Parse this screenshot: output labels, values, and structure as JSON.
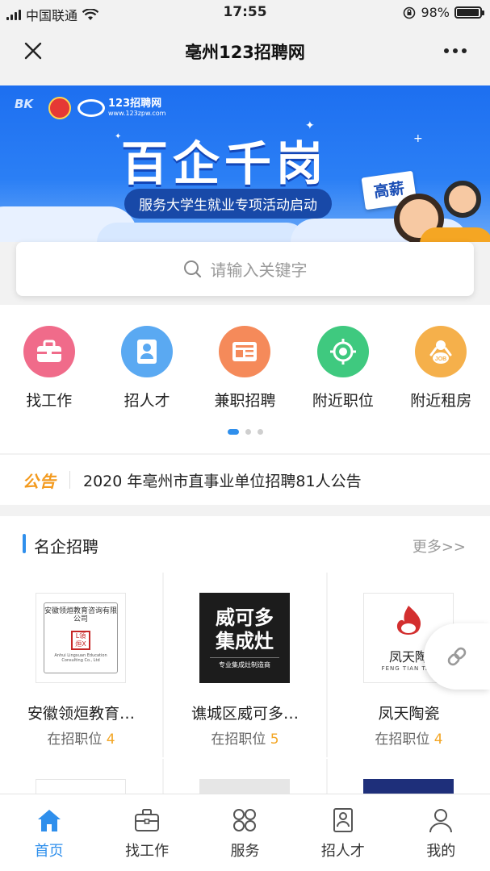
{
  "status_bar": {
    "carrier": "中国联通",
    "time": "17:55",
    "battery": "98%"
  },
  "navbar": {
    "title": "亳州123招聘网"
  },
  "banner": {
    "logo_text": "123招聘网",
    "logo_url_text": "www.123zpw.com",
    "headline": "百企千岗",
    "subtitle": "服务大学生就业专项活动启动",
    "tag": "高薪"
  },
  "search": {
    "placeholder": "请输入关键字"
  },
  "quick_menu": [
    {
      "label": "找工作",
      "icon": "briefcase-icon",
      "color": "#f06b8a"
    },
    {
      "label": "招人才",
      "icon": "resume-icon",
      "color": "#5aa9f2"
    },
    {
      "label": "兼职招聘",
      "icon": "newspaper-icon",
      "color": "#f58a5a"
    },
    {
      "label": "附近职位",
      "icon": "target-icon",
      "color": "#3fc97f"
    },
    {
      "label": "附近租房",
      "icon": "job-person-icon",
      "color": "#f5b04b"
    }
  ],
  "notice": {
    "tag": "公告",
    "text": "2020 年亳州市直事业单位招聘81人公告"
  },
  "famous": {
    "title": "名企招聘",
    "more": "更多>>",
    "position_label": "在招职位",
    "companies": [
      {
        "name": "安徽领烜教育…",
        "count": "4",
        "logo_text": "安徽领烜教育咨询有限公司",
        "logo_sub": "Anhui Lingxuan Education Consulting Co., Ltd"
      },
      {
        "name": "谯城区威可多…",
        "count": "5",
        "logo_text": "威可多集成灶",
        "logo_sub": "专业集成灶制造商"
      },
      {
        "name": "凤天陶瓷",
        "count": "4",
        "logo_text": "凤天陶",
        "logo_sub": "FENG TIAN TAO"
      }
    ]
  },
  "tabbar": [
    {
      "label": "首页",
      "icon": "home-icon",
      "active": true
    },
    {
      "label": "找工作",
      "icon": "briefcase-icon",
      "active": false
    },
    {
      "label": "服务",
      "icon": "grid-icon",
      "active": false
    },
    {
      "label": "招人才",
      "icon": "resume-icon",
      "active": false
    },
    {
      "label": "我的",
      "icon": "user-icon",
      "active": false
    }
  ],
  "colors": {
    "accent": "#2f8fec",
    "notice": "#f39a1e",
    "count": "#f3a625",
    "banner": "#1d6ff0"
  }
}
